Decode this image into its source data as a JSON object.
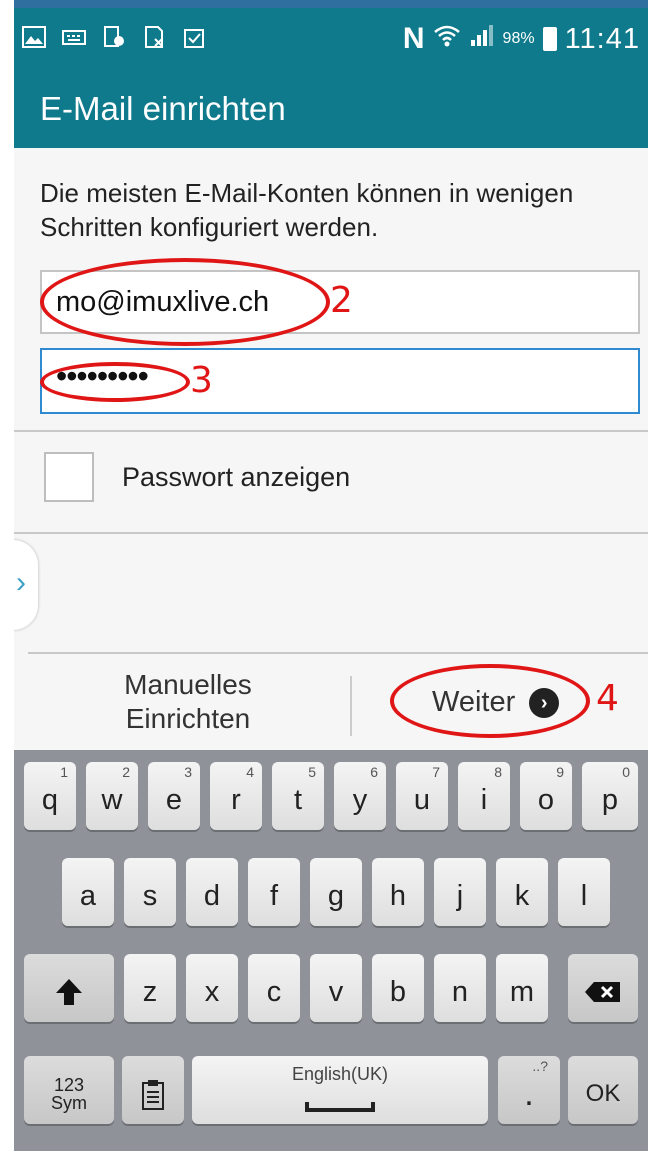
{
  "status_bar": {
    "nfc_label": "N",
    "battery_text": "98%",
    "time": "11:41"
  },
  "action_bar": {
    "title": "E-Mail einrichten"
  },
  "setup": {
    "intro": "Die meisten E-Mail-Konten können in wenigen Schritten konfiguriert werden.",
    "email_value": "mo@imuxlive.ch",
    "password_value": "•••••••••",
    "show_password_label": "Passwort anzeigen",
    "manual_setup_label": "Manuelles Einrichten",
    "next_label": "Weiter"
  },
  "annotations": {
    "step_email": "2",
    "step_password": "3",
    "step_next": "4"
  },
  "keyboard": {
    "row1": [
      {
        "label": "q",
        "hint": "1"
      },
      {
        "label": "w",
        "hint": "2"
      },
      {
        "label": "e",
        "hint": "3"
      },
      {
        "label": "r",
        "hint": "4"
      },
      {
        "label": "t",
        "hint": "5"
      },
      {
        "label": "y",
        "hint": "6"
      },
      {
        "label": "u",
        "hint": "7"
      },
      {
        "label": "i",
        "hint": "8"
      },
      {
        "label": "o",
        "hint": "9"
      },
      {
        "label": "p",
        "hint": "0"
      }
    ],
    "row2": [
      "a",
      "s",
      "d",
      "f",
      "g",
      "h",
      "j",
      "k",
      "l"
    ],
    "row3": [
      "z",
      "x",
      "c",
      "v",
      "b",
      "n",
      "m"
    ],
    "sym_label_top": "123",
    "sym_label_bottom": "Sym",
    "space_label": "English(UK)",
    "period_label": ".",
    "period_hint": "..?",
    "ok_label": "OK"
  },
  "colors": {
    "header": "#0e7a8c",
    "annotation": "#e01616",
    "focus_border": "#2f8ad0"
  }
}
